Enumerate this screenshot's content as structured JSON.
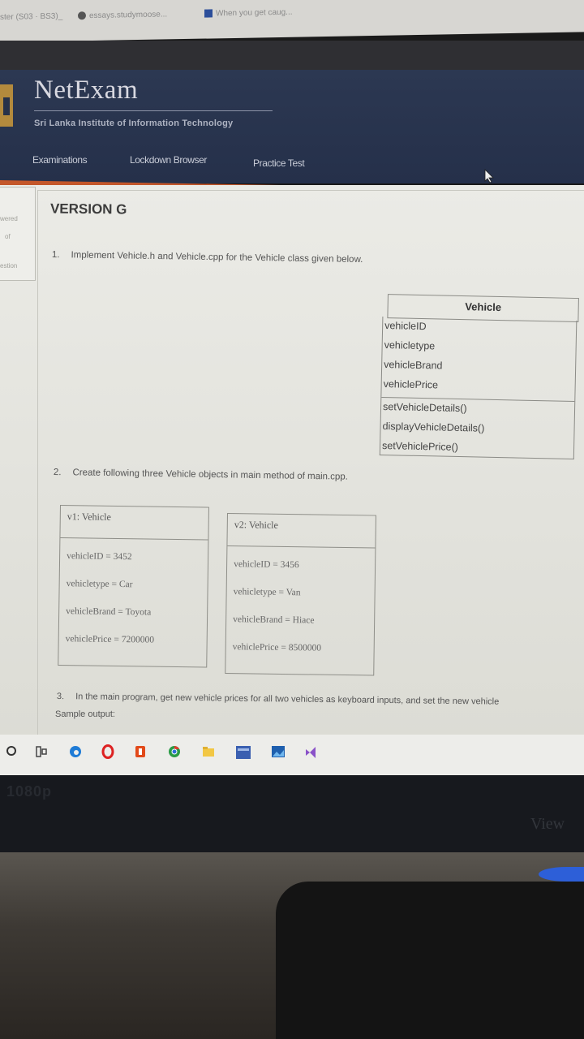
{
  "browser": {
    "tabs": [
      "ster (S03 · BS3)_",
      "essays.studymoose...",
      "When you get caug..."
    ]
  },
  "header": {
    "brand_title": "NetExam",
    "brand_subtitle": "Sri Lanka Institute of Information Technology",
    "nav": [
      "Examinations",
      "Lockdown Browser",
      "Practice Test"
    ]
  },
  "side_panel": {
    "fragments": [
      "wered",
      "of",
      "estion"
    ]
  },
  "exam": {
    "version": "VERSION G",
    "q1": {
      "num": "1.",
      "text": "Implement Vehicle.h and Vehicle.cpp for the Vehicle class given below."
    },
    "class_box": {
      "name": "Vehicle",
      "attributes": [
        "vehicleID",
        "vehicletype",
        "vehicleBrand",
        "vehiclePrice"
      ],
      "methods": [
        "setVehicleDetails()",
        "displayVehicleDetails()",
        "setVehiclePrice()"
      ]
    },
    "q2": {
      "num": "2.",
      "text": "Create following three Vehicle objects in main method of main.cpp."
    },
    "objects": [
      {
        "title": "v1: Vehicle",
        "fields": [
          "vehicleID = 3452",
          "vehicletype = Car",
          "vehicleBrand = Toyota",
          "vehiclePrice = 7200000"
        ]
      },
      {
        "title": "v2: Vehicle",
        "fields": [
          "vehicleID = 3456",
          "vehicletype = Van",
          "vehicleBrand = Hiace",
          "vehiclePrice = 8500000"
        ]
      }
    ],
    "q3": {
      "num": "3.",
      "text": "In the main program, get new vehicle prices for all two vehicles as keyboard inputs, and set the new vehicle"
    },
    "sample_output_label": "Sample output:"
  },
  "bezel": {
    "logo": "1080p",
    "brand": "View"
  }
}
